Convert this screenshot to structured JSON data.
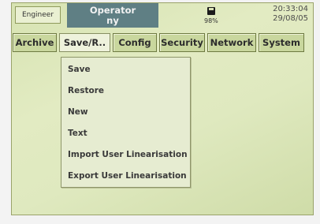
{
  "header": {
    "role_label": "Engineer",
    "operator_title": "Operator",
    "operator_user": "ny",
    "disk_percent": "98%",
    "time": "20:33:04",
    "date": "29/08/05"
  },
  "menu": {
    "items": [
      {
        "label": "Archive"
      },
      {
        "label": "Save/R.."
      },
      {
        "label": "Config"
      },
      {
        "label": "Security"
      },
      {
        "label": "Network"
      },
      {
        "label": "System"
      }
    ],
    "active": "Save/R.."
  },
  "dropdown": {
    "items": [
      {
        "label": "Save"
      },
      {
        "label": "Restore"
      },
      {
        "label": "New"
      },
      {
        "label": "Text"
      },
      {
        "label": "Import User Linearisation"
      },
      {
        "label": "Export User Linearisation"
      }
    ]
  }
}
